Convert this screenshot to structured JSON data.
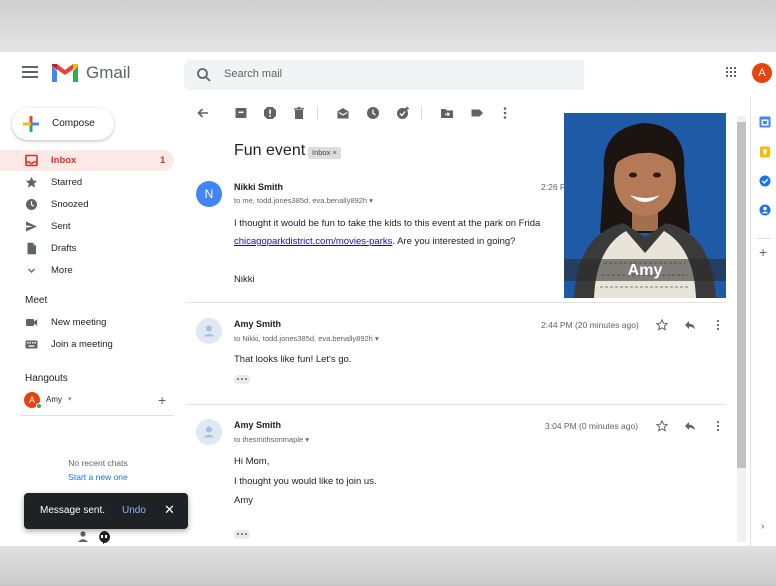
{
  "header": {
    "app_name": "Gmail",
    "search_placeholder": "Search mail",
    "account_initial": "A"
  },
  "sidebar": {
    "compose_label": "Compose",
    "items": [
      {
        "label": "Inbox",
        "count": "1",
        "icon": "inbox-icon",
        "active": true
      },
      {
        "label": "Starred",
        "icon": "star-icon"
      },
      {
        "label": "Snoozed",
        "icon": "clock-icon"
      },
      {
        "label": "Sent",
        "icon": "send-icon"
      },
      {
        "label": "Drafts",
        "icon": "draft-icon"
      },
      {
        "label": "More",
        "icon": "chevron-down-icon"
      }
    ],
    "meet": {
      "title": "Meet",
      "items": [
        {
          "label": "New meeting",
          "icon": "video-icon"
        },
        {
          "label": "Join a meeting",
          "icon": "keyboard-icon"
        }
      ]
    },
    "hangouts": {
      "title": "Hangouts",
      "user_initial": "A",
      "user_name": "Amy",
      "no_chats": "No recent chats",
      "start_chat": "Start a new one"
    }
  },
  "snackbar": {
    "message": "Message sent.",
    "action": "Undo"
  },
  "thread": {
    "subject": "Fun event",
    "label": "Inbox",
    "messages": [
      {
        "avatar_initial": "N",
        "sender": "Nikki Smith",
        "recipients": "to me, todd.jones385d, eva.benally892h",
        "time": "2:26 P",
        "body_before_link": "I thought it would be fun to take the kids to this event at the park on Frida",
        "link": "chicagoparkdistrict.com/movies-parks",
        "body_after_link": ". Are you interested in going?",
        "signature": "Nikki"
      },
      {
        "sender": "Amy Smith",
        "recipients": "to Nikki, todd.jones385d, eva.benally892h",
        "time": "2:44 PM (20 minutes ago)",
        "body": "That looks like fun!  Let's go."
      },
      {
        "sender": "Amy Smith",
        "recipients": "to thesmithsonmaple",
        "time": "3:04 PM (0 minutes ago)",
        "greeting": "Hi Mom,",
        "body": "I thought you would like to join us.",
        "signature": "Amy"
      }
    ]
  },
  "presenter": {
    "name": "Amy"
  },
  "colors": {
    "accent_red": "#d93025",
    "link_blue": "#1a73e8",
    "presenter_bg": "#1f5aa6"
  }
}
